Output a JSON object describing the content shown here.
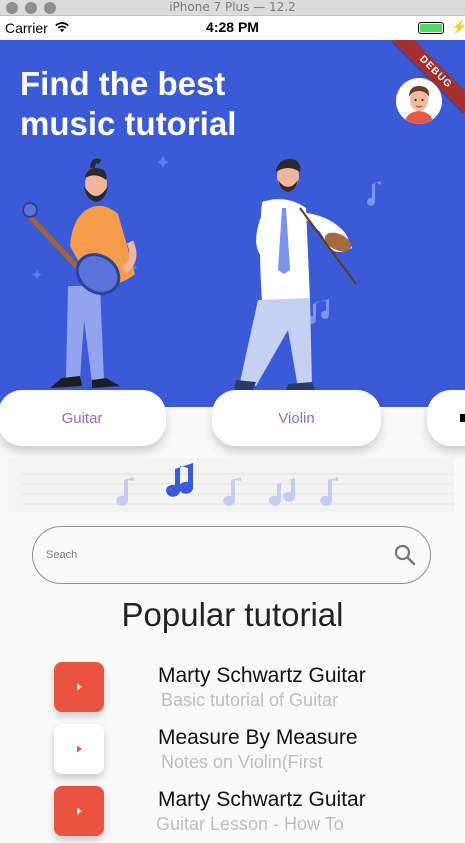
{
  "window": {
    "title": "iPhone 7 Plus — 12.2"
  },
  "status_bar": {
    "carrier": "Carrier",
    "time": "4:28 PM",
    "battery_level": 1.0
  },
  "debug_banner": "DEBUG",
  "hero": {
    "title_line1": "Find the best",
    "title_line2": "music tutorial"
  },
  "categories": [
    {
      "label": "Guitar"
    },
    {
      "label": "Violin"
    }
  ],
  "search": {
    "placeholder": "Seach"
  },
  "section_title": "Popular tutorial",
  "tutorials": [
    {
      "title": "Marty Schwartz Guitar",
      "subtitle": "Basic tutorial of Guitar",
      "button_style": "red"
    },
    {
      "title": "Measure By Measure",
      "subtitle": "Notes on Violin(First",
      "button_style": "white"
    },
    {
      "title": "Marty Schwartz Guitar",
      "subtitle": "Guitar Lesson - How To",
      "button_style": "red"
    }
  ],
  "colors": {
    "hero_bg": "#3b5ad7",
    "accent_red": "#e95340",
    "category_text": "#9a6bbb",
    "subtitle_gray": "#bdbdbd"
  },
  "icons": {
    "wifi": "wifi-icon",
    "battery": "battery-icon",
    "search": "search-icon",
    "play": "play-icon",
    "note": "music-note-icon"
  }
}
